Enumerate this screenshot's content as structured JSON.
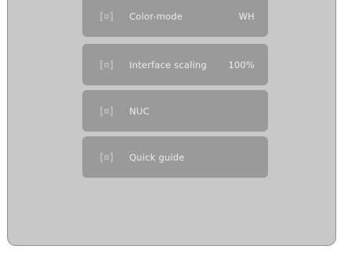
{
  "menu": {
    "items": [
      {
        "icon": "focus-frame-icon",
        "label": "Color-mode",
        "value": "WH"
      },
      {
        "icon": "focus-frame-icon",
        "label": "Interface scaling",
        "value": "100%"
      },
      {
        "icon": "focus-frame-icon",
        "label": "NUC",
        "value": ""
      },
      {
        "icon": "focus-frame-icon",
        "label": "Quick guide",
        "value": ""
      }
    ]
  },
  "colors": {
    "screen_background": "#c8c8c8",
    "item_background": "#9a9a9a",
    "item_text": "#ececec"
  }
}
